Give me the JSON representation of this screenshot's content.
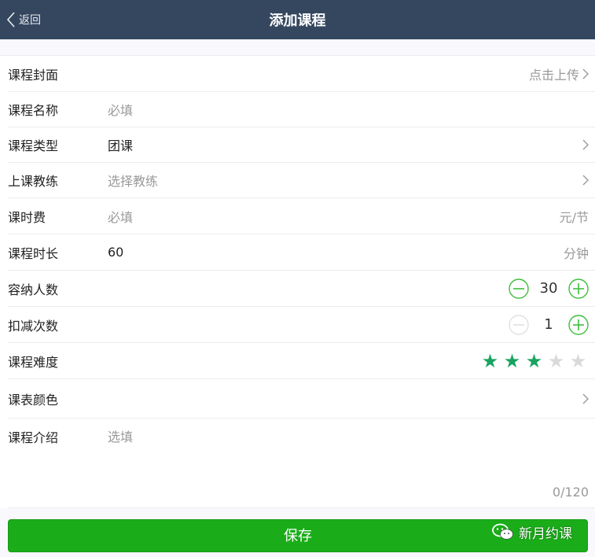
{
  "nav": {
    "back_label": "返回",
    "title": "添加课程"
  },
  "form": {
    "cover": {
      "label": "课程封面",
      "action": "点击上传"
    },
    "name": {
      "label": "课程名称",
      "placeholder": "必填"
    },
    "type": {
      "label": "课程类型",
      "value": "团课"
    },
    "coach": {
      "label": "上课教练",
      "placeholder": "选择教练"
    },
    "fee": {
      "label": "课时费",
      "placeholder": "必填",
      "unit": "元/节"
    },
    "duration": {
      "label": "课程时长",
      "value": "60",
      "unit": "分钟"
    },
    "capacity": {
      "label": "容纳人数",
      "value": "30"
    },
    "deduct": {
      "label": "扣减次数",
      "value": "1"
    },
    "difficulty": {
      "label": "课程难度",
      "rating": 3,
      "max": 5,
      "star_char": "★"
    },
    "color": {
      "label": "课表颜色"
    },
    "intro": {
      "label": "课程介绍",
      "placeholder": "选填",
      "counter": "0/120"
    }
  },
  "save_label": "保存",
  "watermark": {
    "text": "新月约课",
    "icon": "wechat-icon"
  },
  "colors": {
    "navbar": "#35475f",
    "accent_green": "#1aad19",
    "stepper_green": "#3fbf3f",
    "star_on": "#1aa360",
    "star_off": "#d9d9d9"
  }
}
